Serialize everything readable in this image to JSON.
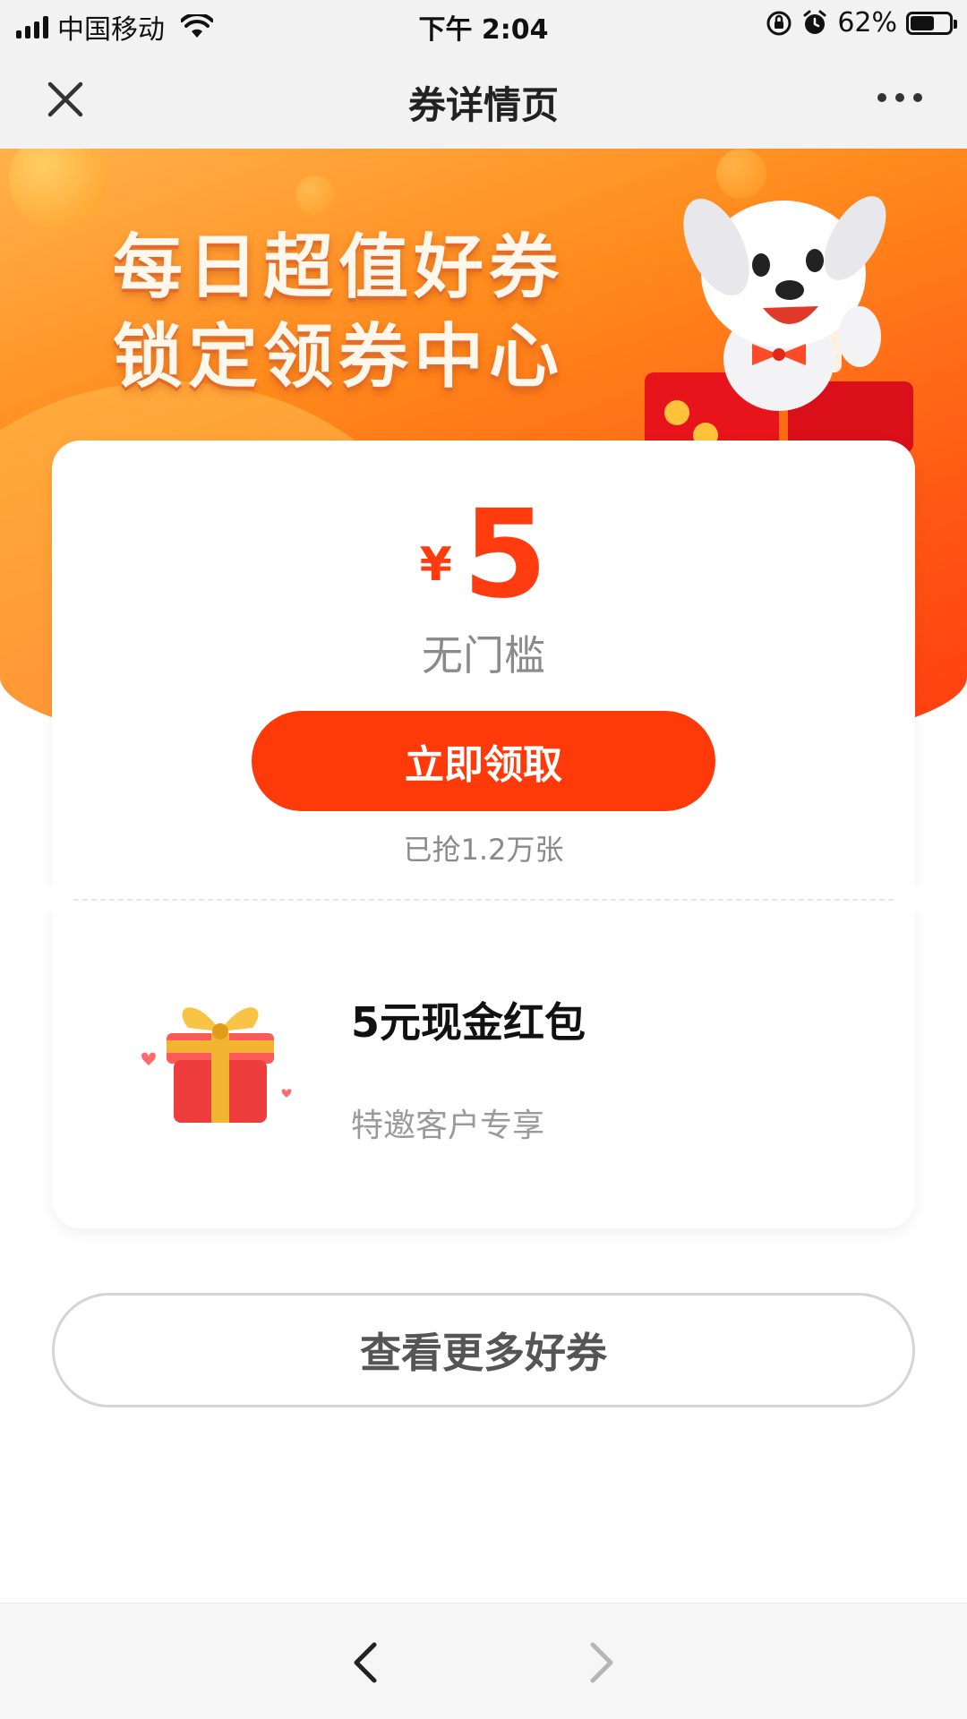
{
  "status_bar": {
    "carrier": "中国移动",
    "time": "下午 2:04",
    "battery": "62%",
    "battery_level": 0.62,
    "icons": [
      "signal-icon",
      "wifi-icon",
      "rotation-lock-icon",
      "alarm-icon",
      "battery-icon"
    ]
  },
  "nav": {
    "title": "券详情页",
    "close_icon": "close-icon",
    "more_icon": "more-icon"
  },
  "banner": {
    "line1": "每日超值好券",
    "line2": "锁定领券中心",
    "colors": {
      "start": "#ffb24a",
      "end": "#ff3a10"
    }
  },
  "coupon": {
    "currency": "¥",
    "amount": "5",
    "threshold": "无门槛",
    "claim_label": "立即领取",
    "claimed_text": "已抢1.2万张",
    "accent": "#ff3a0a"
  },
  "reward": {
    "title": "5元现金红包",
    "subtitle": "特邀客户专享",
    "icon": "gift-box-icon"
  },
  "more_button": "查看更多好券",
  "toolbar": {
    "back_icon": "back-arrow-icon",
    "forward_icon": "forward-arrow-icon"
  }
}
